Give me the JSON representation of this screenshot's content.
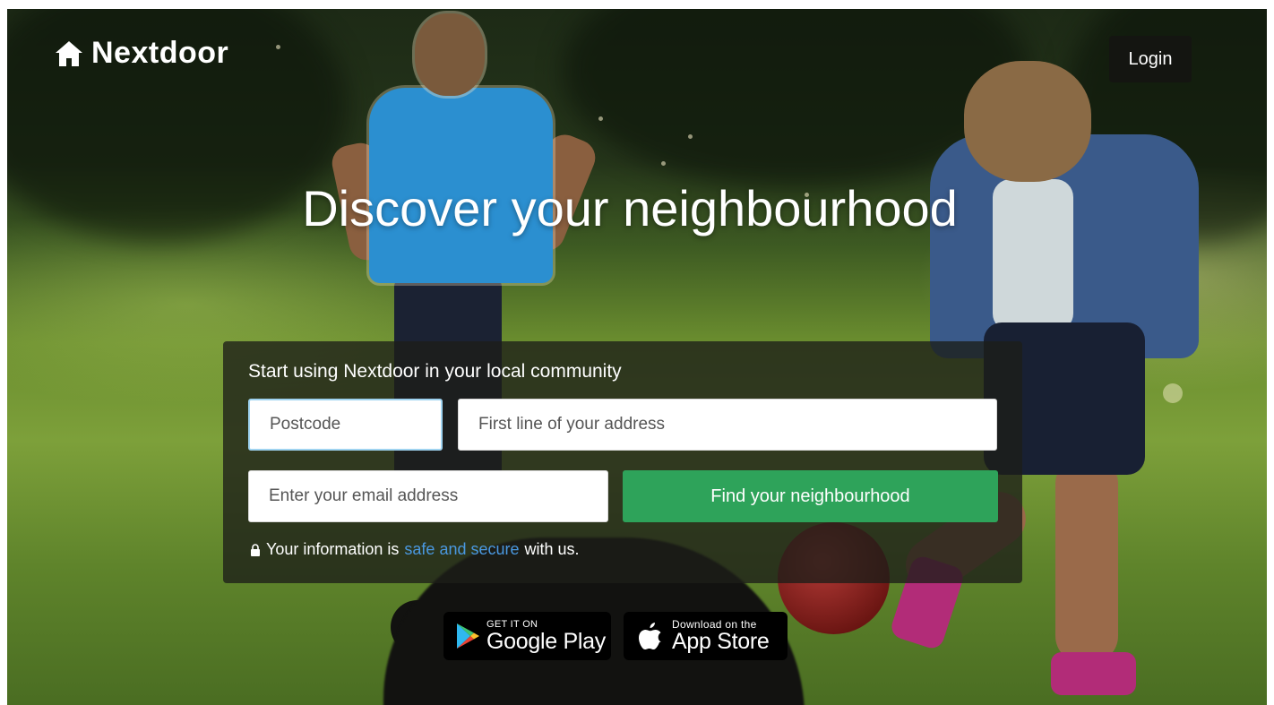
{
  "header": {
    "brand": "Nextdoor",
    "login_label": "Login"
  },
  "hero": {
    "headline": "Discover your neighbourhood"
  },
  "signup": {
    "title": "Start using Nextdoor in your local community",
    "postcode_placeholder": "Postcode",
    "address_placeholder": "First line of your address",
    "email_placeholder": "Enter your email address",
    "submit_label": "Find your neighbourhood",
    "secure_prefix": "Your information is",
    "secure_link": "safe and secure",
    "secure_suffix": "with us."
  },
  "badges": {
    "google_small": "GET IT ON",
    "google_big": "Google Play",
    "apple_small": "Download on the",
    "apple_big": "App Store"
  },
  "icons": {
    "logo": "house-icon",
    "lock": "lock-icon",
    "google_play": "google-play-icon",
    "apple": "apple-icon"
  },
  "colors": {
    "submit": "#2ea35a",
    "link": "#4a98e0",
    "focus_border": "#9fd3f0"
  }
}
